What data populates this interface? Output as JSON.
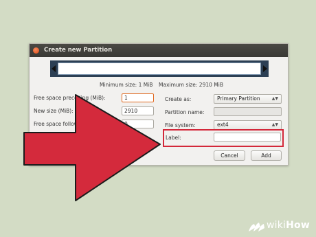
{
  "dialog": {
    "title": "Create new Partition",
    "min_size": "Minimum size: 1 MiB",
    "max_size": "Maximum size: 2910 MiB",
    "free_preceding_label": "Free space preceding (MiB):",
    "free_preceding_value": "1",
    "new_size_label": "New size (MiB):",
    "new_size_value": "2910",
    "free_following_label": "Free space following (MiB):",
    "free_following_value": "0",
    "create_as_label": "Create as:",
    "create_as_value": "Primary Partition",
    "partition_name_label": "Partition name:",
    "file_system_label": "File system:",
    "file_system_value": "ext4",
    "label_label": "Label:",
    "label_value": "",
    "cancel_label": "Cancel",
    "add_label": "Add"
  },
  "watermark": {
    "wiki": "wiki",
    "how": "How"
  },
  "colors": {
    "arrow": "#d42a3c",
    "highlight": "#d3283a",
    "focus": "#e0681e"
  }
}
